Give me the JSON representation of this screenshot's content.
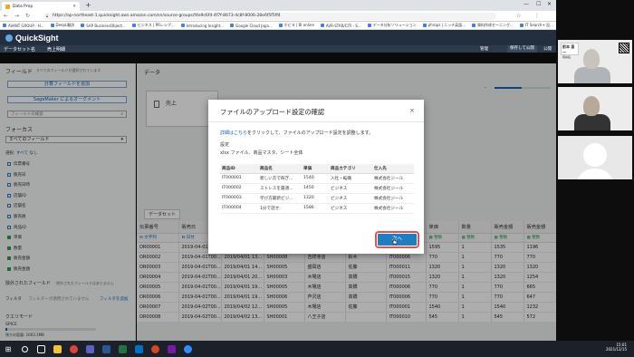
{
  "browser": {
    "tab_title": "Data Prep",
    "new_tab": "+",
    "url": "https://ap-northeast-1.quicksight.aws.amazon.com/sn/source-groups/f4e9c6f4-4f7f-8673-4c8f-8006-28e6f5f5ff4",
    "bookmarks": [
      "AVANT GROUP - H...",
      "DeepL翻訳",
      "SAP BusinessObject...",
      "ビジネス | PRレシプ...",
      "Introducing Insight...",
      "Google Cloud Japa...",
      "ホビヨ | BI online",
      "AVR-STAR/CITI - S...",
      "データ分析ソリューション",
      "phrops | ニッチ英語...",
      "資料作成セーニング...",
      "IT Search+ 記..."
    ]
  },
  "app": {
    "name": "QuickSight",
    "breadcrumb_parent": "データセット名",
    "breadcrumb_current": "売上明細",
    "actions": [
      "管理",
      "保存して公開",
      "公開"
    ]
  },
  "sidebar": {
    "fields_title": "フィールド",
    "fields_note": "すべてのフィールドが選択されています",
    "add_calc_button": "計算フィールドを追加",
    "sagemaker_button": "SageMaker によるオーグメント",
    "search_placeholder": "フィールドの検索",
    "focus_title": "フォーカス",
    "focus_value": "すべてのフィールド",
    "select_label": "選択:",
    "select_all": "すべて",
    "select_none": "なし",
    "fields": [
      {
        "name": "伝票番号",
        "type": "text"
      },
      {
        "name": "販売日",
        "type": "text"
      },
      {
        "name": "販売日時",
        "type": "text"
      },
      {
        "name": "店舗ID",
        "type": "text"
      },
      {
        "name": "店舗名",
        "type": "text"
      },
      {
        "name": "販売員",
        "type": "text"
      },
      {
        "name": "商品ID",
        "type": "text"
      },
      {
        "name": "単価",
        "type": "num"
      },
      {
        "name": "数量",
        "type": "num"
      },
      {
        "name": "販売金額",
        "type": "num"
      },
      {
        "name": "販売金額",
        "type": "num"
      }
    ],
    "excluded_title": "除外されたフィールド",
    "excluded_note": "除外されたフィールドはありません",
    "filter_label": "フィルタ",
    "filter_note": "フィルターが適用されていません",
    "filter_link": "フィルタを追加",
    "query_mode_title": "クエリモード",
    "spice_label": "SPICE",
    "spice_capacity": "残りの容量: 1003.1MB"
  },
  "main": {
    "data_header": "データ",
    "canvas_card": "売上",
    "dataset_tab": "データセット",
    "columns": [
      "伝票番号",
      "販売日",
      "販売日時",
      "店舗ID",
      "店舗名",
      "販売員",
      "商品ID",
      "単価",
      "数量",
      "販売金額",
      "販売金額"
    ],
    "types": [
      "文字列",
      "日付",
      "文字列",
      "文字列",
      "文字列",
      "文字列",
      "文字列",
      "整数",
      "整数",
      "整数",
      "整数"
    ],
    "rows": [
      [
        "OR00001",
        "2019-04-01T00...",
        "2019/04/01 11...",
        "SH00007",
        "八王子店",
        "高橋",
        "IT000003",
        "1595",
        "1",
        "1535",
        "1196"
      ],
      [
        "OR00002",
        "2019-04-01T00...",
        "2019/04/01 13...",
        "SH00008",
        "吉祥寺店",
        "鈴木",
        "IT000006",
        "770",
        "1",
        "770",
        "770"
      ],
      [
        "OR00003",
        "2019-04-01T00...",
        "2019/04/01 14...",
        "SH00005",
        "盛岡店",
        "佐藤",
        "IT000011",
        "1320",
        "1",
        "1320",
        "1320"
      ],
      [
        "OR00004",
        "2019-04-01T00...",
        "2019/04/01 20...",
        "SH00003",
        "木場店",
        "高橋",
        "IT000015",
        "1320",
        "1",
        "1320",
        "1254"
      ],
      [
        "OR00005",
        "2019-04-01T00...",
        "2019/04/01 19...",
        "SH00005",
        "木場店",
        "高橋",
        "IT000006",
        "770",
        "1",
        "770",
        "665"
      ],
      [
        "OR00006",
        "2019-04-01T00...",
        "2019/04/01 19...",
        "SH00006",
        "芦沢店",
        "高橋",
        "IT000006",
        "770",
        "1",
        "770",
        "647"
      ],
      [
        "OR00007",
        "2019-04-02T00...",
        "2019/04/02 12...",
        "SH00005",
        "木場店",
        "佐藤",
        "IT000001",
        "1540",
        "1",
        "1540",
        "1232"
      ],
      [
        "OR00008",
        "2019-04-02T00...",
        "2019/04/02 13...",
        "SH00001",
        "八王子店",
        "",
        "IT000010",
        "545",
        "1",
        "545",
        "572"
      ]
    ]
  },
  "modal": {
    "title": "ファイルのアップロード設定の確認",
    "close": "×",
    "desc_link": "詳細はこちら",
    "desc_text": "をクリックして、ファイルのアップロード設定を調整します。",
    "settings_label": "設定",
    "settings_value": "xlsx ファイル、商品マスタ、シート全体",
    "table_headers": [
      "商品ID",
      "商品名",
      "単価",
      "商品カテゴリ",
      "仕入先"
    ],
    "table_rows": [
      [
        "IT000001",
        "新しい方で稼ぎ...",
        "1540",
        "入社・転職",
        "株式会社ジール"
      ],
      [
        "IT000002",
        "ストレスを最適...",
        "1450",
        "ビジネス",
        "株式会社ジール"
      ],
      [
        "IT000003",
        "学び方最新ビジ...",
        "1320",
        "ビジネス",
        "株式会社ジール"
      ],
      [
        "IT000004",
        "1分で話せ",
        "1586",
        "ビジネス",
        "株式会社ジール"
      ]
    ],
    "next_button": "次へ"
  },
  "gallery": {
    "card_name": "前本 直一",
    "card_role": "取締役"
  },
  "taskbar": {
    "time": "15:01",
    "date": "2021/12/15"
  }
}
